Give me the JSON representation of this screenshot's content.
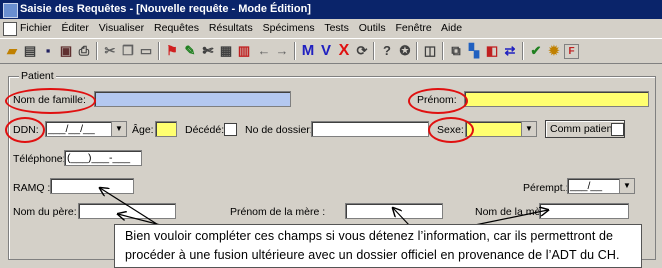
{
  "window": {
    "title": "Saisie des Requêtes - [Nouvelle requête - Mode Édition]"
  },
  "menu": [
    "Fichier",
    "Éditer",
    "Visualiser",
    "Requêtes",
    "Résultats",
    "Spécimens",
    "Tests",
    "Outils",
    "Fenêtre",
    "Aide"
  ],
  "toolbar": {
    "m_label": "M",
    "v_label": "V",
    "x_label": "X"
  },
  "patient": {
    "group_label": "Patient",
    "nom_label": "Nom de famille:",
    "nom_value": "",
    "prenom_label": "Prénom:",
    "prenom_value": "",
    "ddn_label": "DDN:",
    "ddn_value": "___/__/__",
    "age_label": "Âge:",
    "decede_label": "Décédé:",
    "dossier_label": "No de dossier:",
    "sexe_label": "Sexe:",
    "comm_label": "Comm patient",
    "telephone_label": "Téléphone:",
    "telephone_value": "(___)___-___",
    "ramq_label": "RAMQ :",
    "perempt_label": "Pérempt.:",
    "perempt_value": "___/__",
    "nom_pere_label": "Nom du père:",
    "prenom_mere_label": "Prénom de la mère :",
    "nom_mere_label": "Nom de la mère :"
  },
  "annotation": {
    "text": "Bien vouloir compléter ces champs si vous détenez l’information, car ils permettront de procéder à une fusion ultérieure avec un dossier officiel en provenance de l’ADT du CH.",
    "highlight_color": "#e01010"
  }
}
